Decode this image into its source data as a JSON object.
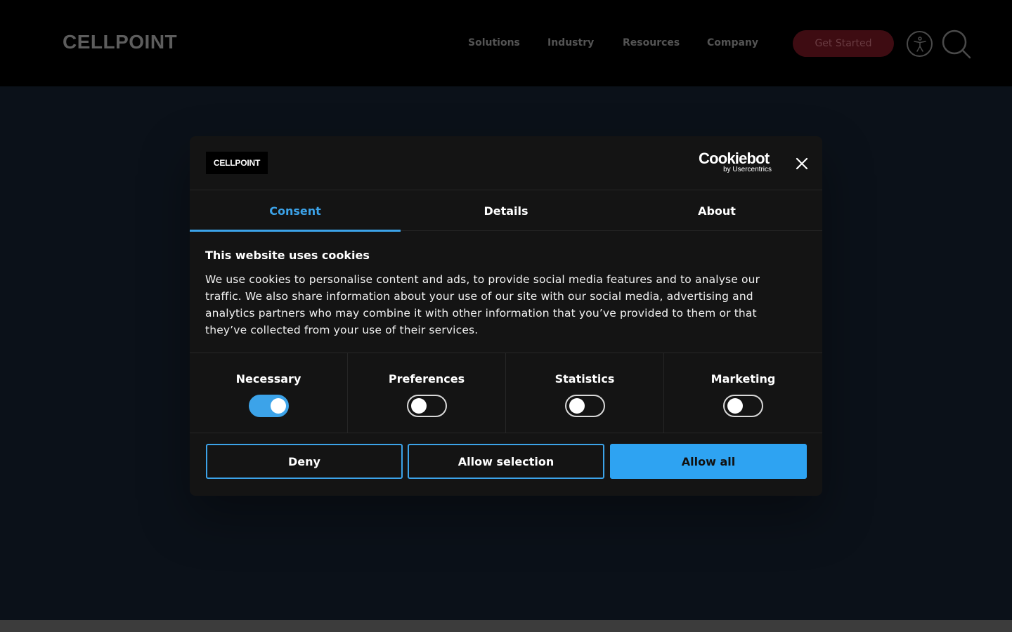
{
  "site": {
    "logo": "CELLPOINT",
    "nav": [
      "Solutions",
      "Industry",
      "Resources",
      "Company"
    ],
    "cta": "Get Started"
  },
  "dialog": {
    "brand_badge": "CELLPOINT",
    "provider_name": "Cookiebot",
    "provider_sub": "by Usercentrics",
    "tabs": [
      {
        "label": "Consent",
        "active": true
      },
      {
        "label": "Details",
        "active": false
      },
      {
        "label": "About",
        "active": false
      }
    ],
    "title": "This website uses cookies",
    "text": "We use cookies to personalise content and ads, to provide social media features and to analyse our traffic. We also share information about your use of our site with our social media, advertising and analytics partners who may combine it with other information that you’ve provided to them or that they’ve collected from your use of their services.",
    "toggles": [
      {
        "label": "Necessary",
        "on": true
      },
      {
        "label": "Preferences",
        "on": false
      },
      {
        "label": "Statistics",
        "on": false
      },
      {
        "label": "Marketing",
        "on": false
      }
    ],
    "buttons": {
      "deny": "Deny",
      "allow_selection": "Allow selection",
      "allow_all": "Allow all"
    }
  },
  "colors": {
    "accent": "#3ca3e9",
    "dialog_bg": "#141414",
    "header_bg": "#000000",
    "page_bg": "#0b1119"
  },
  "icons": {
    "accessibility": "accessibility-icon",
    "search": "search-icon",
    "close": "close-icon"
  }
}
